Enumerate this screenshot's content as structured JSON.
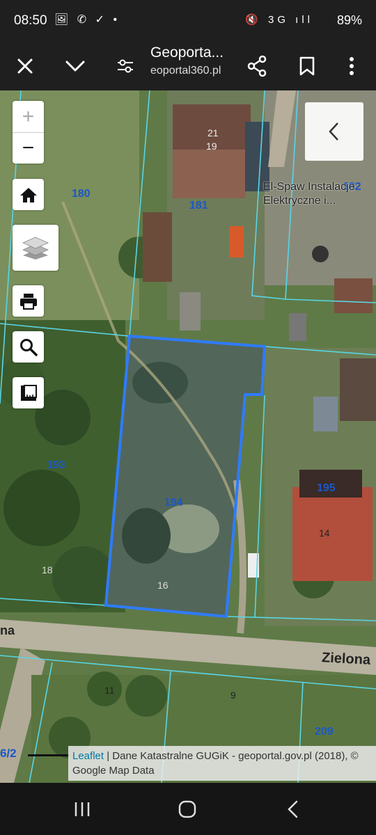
{
  "status": {
    "time": "08:50",
    "left_icons": "🖼 ✆ ✓ •",
    "right_icons": "🔇 3G ıll",
    "battery": "89%"
  },
  "toolbar": {
    "title": "Geoporta...",
    "subtitle": "eoportal360.pl",
    "icons": [
      "close-icon",
      "chevron-down-icon",
      "tune-icon",
      "share-icon",
      "bookmark-icon",
      "more-vert-icon"
    ]
  },
  "map": {
    "controls": {
      "zoom_in": "+",
      "zoom_out": "−",
      "icons": [
        "home-icon",
        "layers-icon",
        "print-icon",
        "search-icon",
        "measure-icon",
        "chevron-left-icon"
      ]
    },
    "parcel_labels": [
      "180",
      "181",
      "182",
      "193",
      "194",
      "195",
      "209"
    ],
    "house_numbers": [
      "21",
      "19",
      "14",
      "18",
      "16",
      "11",
      "9"
    ],
    "street_name": "Zielona",
    "street_fragment": "na",
    "edge_label": "6/2",
    "poi_label": "El-Spaw Instalacje\nElektryczne i...",
    "attribution": {
      "link": "Leaflet",
      "text": " | Dane Katastralne GUGiK - geoportal.gov.pl (2018), © Google Map Data"
    },
    "selected_parcel_color": "#2f7bff",
    "parcel_line_color": "#58d6e6"
  },
  "navbar": {
    "icons": [
      "recent-apps-icon",
      "home-circle-icon",
      "back-icon"
    ]
  }
}
